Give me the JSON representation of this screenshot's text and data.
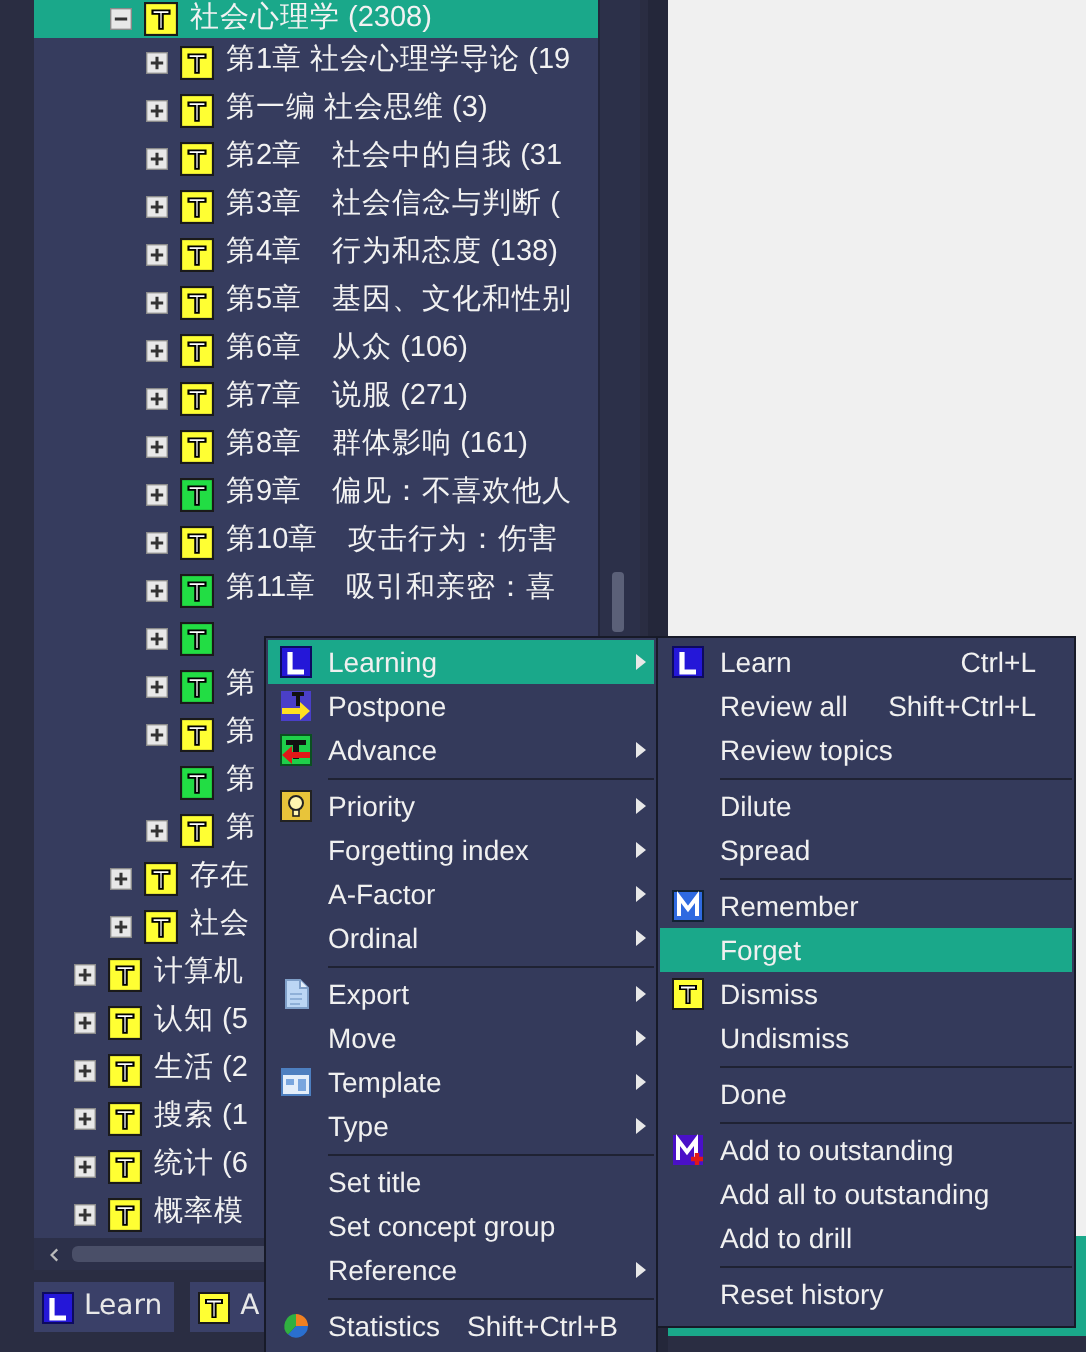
{
  "tree": {
    "items": [
      {
        "children": [
          {
            "label": "社会心理学 (2308)",
            "color": "#ffff33",
            "kind": "folder",
            "expanded": true,
            "selected": true,
            "children": [
              {
                "label": "第1章 社会心理学导论 (19",
                "color": "#ffff33",
                "kind": "folder",
                "expanded": false,
                "selected": false
              },
              {
                "label": "第一编 社会思维 (3)",
                "color": "#ffff33",
                "kind": "folder",
                "expanded": false,
                "selected": false
              },
              {
                "label": "第2章　社会中的自我 (31",
                "color": "#ffff33",
                "kind": "folder",
                "expanded": false,
                "selected": false
              },
              {
                "label": "第3章　社会信念与判断 (",
                "color": "#ffff33",
                "kind": "folder",
                "expanded": false,
                "selected": false
              },
              {
                "label": "第4章　行为和态度 (138)",
                "color": "#ffff33",
                "kind": "folder",
                "expanded": false,
                "selected": false
              },
              {
                "label": "第5章　基因、文化和性别",
                "color": "#ffff33",
                "kind": "folder",
                "expanded": false,
                "selected": false
              },
              {
                "label": "第6章　从众 (106)",
                "color": "#ffff33",
                "kind": "folder",
                "expanded": false,
                "selected": false
              },
              {
                "label": "第7章　说服 (271)",
                "color": "#ffff33",
                "kind": "folder",
                "expanded": false,
                "selected": false
              },
              {
                "label": "第8章　群体影响 (161)",
                "color": "#ffff33",
                "kind": "folder",
                "expanded": false,
                "selected": false
              },
              {
                "label": "第9章　偏见：不喜欢他人",
                "color": "#22dd44",
                "kind": "folder",
                "expanded": false,
                "selected": false
              },
              {
                "label": "第10章　攻击行为：伤害",
                "color": "#ffff33",
                "kind": "folder",
                "expanded": false,
                "selected": false
              },
              {
                "label": "第11章　吸引和亲密：喜",
                "color": "#22dd44",
                "kind": "folder",
                "expanded": false,
                "selected": false
              },
              {
                "color": "#22dd44",
                "kind": "folder",
                "expanded": false,
                "selected": false
              },
              {
                "label": "第",
                "color": "#22dd44",
                "kind": "folder",
                "expanded": false,
                "selected": false
              },
              {
                "label": "第",
                "color": "#ffff33",
                "kind": "folder",
                "expanded": false,
                "selected": false
              },
              {
                "label": "第",
                "color": "#22dd44",
                "kind": "leaf",
                "selected": false
              },
              {
                "label": "第",
                "color": "#ffff33",
                "kind": "folder",
                "expanded": false,
                "selected": false
              }
            ]
          },
          {
            "label": "存在",
            "color": "#ffff33",
            "kind": "folder",
            "expanded": false,
            "selected": false
          },
          {
            "label": "社会",
            "color": "#ffff33",
            "kind": "folder",
            "expanded": false,
            "selected": false
          }
        ]
      },
      {
        "label": "计算机",
        "color": "#ffff33",
        "kind": "folder",
        "expanded": false,
        "selected": false
      },
      {
        "label": "认知 (5",
        "color": "#ffff33",
        "kind": "folder",
        "expanded": false,
        "selected": false
      },
      {
        "label": "生活 (2",
        "color": "#ffff33",
        "kind": "folder",
        "expanded": false,
        "selected": false
      },
      {
        "label": "搜索 (1",
        "color": "#ffff33",
        "kind": "folder",
        "expanded": false,
        "selected": false
      },
      {
        "label": "统计 (6",
        "color": "#ffff33",
        "kind": "folder",
        "expanded": false,
        "selected": false
      },
      {
        "label": "概率模",
        "color": "#ffff33",
        "kind": "folder",
        "expanded": false,
        "selected": false
      }
    ]
  },
  "toolbar": [
    {
      "label": "Learn"
    },
    {
      "label": "A"
    }
  ],
  "context_menu": {
    "items": [
      {
        "kind": "item",
        "label": "Learning",
        "submenu": true,
        "selected": true
      },
      {
        "kind": "item",
        "label": "Postpone",
        "submenu": false,
        "selected": false
      },
      {
        "kind": "item",
        "label": "Advance",
        "submenu": true,
        "selected": false
      },
      {
        "kind": "separator"
      },
      {
        "kind": "item",
        "label": "Priority",
        "submenu": true,
        "selected": false
      },
      {
        "kind": "item",
        "label": "Forgetting index",
        "submenu": true,
        "selected": false
      },
      {
        "kind": "item",
        "label": "A-Factor",
        "submenu": true,
        "selected": false
      },
      {
        "kind": "item",
        "label": "Ordinal",
        "submenu": true,
        "selected": false
      },
      {
        "kind": "separator"
      },
      {
        "kind": "item",
        "label": "Export",
        "submenu": true,
        "selected": false
      },
      {
        "kind": "item",
        "label": "Move",
        "submenu": true,
        "selected": false
      },
      {
        "kind": "item",
        "label": "Template",
        "submenu": true,
        "selected": false
      },
      {
        "kind": "item",
        "label": "Type",
        "submenu": true,
        "selected": false
      },
      {
        "kind": "separator"
      },
      {
        "kind": "item",
        "label": "Set title",
        "submenu": false,
        "selected": false
      },
      {
        "kind": "item",
        "label": "Set concept group",
        "submenu": false,
        "selected": false
      },
      {
        "kind": "item",
        "label": "Reference",
        "submenu": true,
        "selected": false
      },
      {
        "kind": "separator"
      },
      {
        "kind": "item",
        "label": "Statistics",
        "shortcut": "Shift+Ctrl+B",
        "submenu": false,
        "selected": false
      }
    ]
  },
  "submenu": {
    "items": [
      {
        "kind": "item",
        "label": "Learn",
        "shortcut": "Ctrl+L",
        "selected": false
      },
      {
        "kind": "item",
        "label": "Review all",
        "shortcut": "Shift+Ctrl+L",
        "selected": false
      },
      {
        "kind": "item",
        "label": "Review topics",
        "selected": false
      },
      {
        "kind": "separator"
      },
      {
        "kind": "item",
        "label": "Dilute",
        "selected": false
      },
      {
        "kind": "item",
        "label": "Spread",
        "selected": false
      },
      {
        "kind": "separator"
      },
      {
        "kind": "item",
        "label": "Remember",
        "selected": false
      },
      {
        "kind": "item",
        "label": "Forget",
        "selected": true
      },
      {
        "kind": "item",
        "label": "Dismiss",
        "selected": false
      },
      {
        "kind": "item",
        "label": "Undismiss",
        "selected": false
      },
      {
        "kind": "separator"
      },
      {
        "kind": "item",
        "label": "Done",
        "selected": false
      },
      {
        "kind": "separator"
      },
      {
        "kind": "item",
        "label": "Add to outstanding",
        "selected": false
      },
      {
        "kind": "item",
        "label": "Add all to outstanding",
        "selected": false
      },
      {
        "kind": "item",
        "label": "Add to drill",
        "selected": false
      },
      {
        "kind": "separator"
      },
      {
        "kind": "item",
        "label": "Reset history",
        "selected": false
      }
    ]
  }
}
